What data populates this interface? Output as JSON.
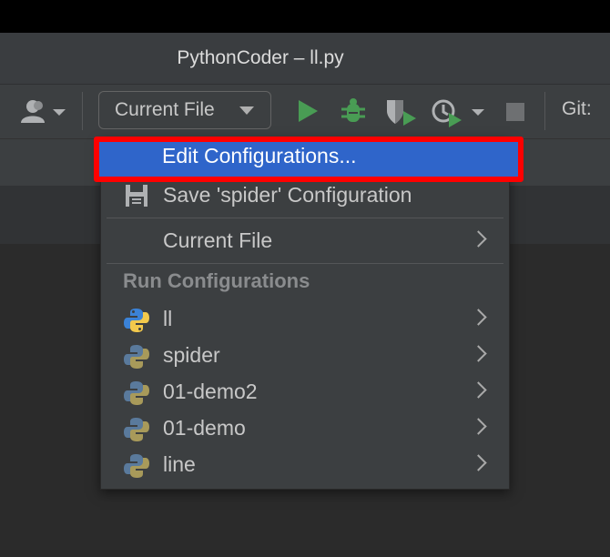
{
  "window": {
    "title": "PythonCoder – ll.py"
  },
  "toolbar": {
    "user_icon": "user-icon",
    "run_config_combo": "Current File",
    "run_icon": "run-icon",
    "debug_icon": "debug-icon",
    "coverage_icon": "coverage-icon",
    "profile_icon": "profile-icon",
    "stop_icon": "stop-icon",
    "git_label": "Git:"
  },
  "menu": {
    "edit_configurations": "Edit Configurations...",
    "save_configuration": "Save 'spider' Configuration",
    "current_file": "Current File",
    "section_header": "Run Configurations",
    "configs": [
      {
        "label": "ll"
      },
      {
        "label": "spider"
      },
      {
        "label": "01-demo2"
      },
      {
        "label": "01-demo"
      },
      {
        "label": "line"
      }
    ]
  },
  "colors": {
    "accent_run": "#499c54",
    "selection": "#2f65ca",
    "highlight_border": "#ff0000",
    "python_active_blue": "#3b82d6",
    "python_active_yellow": "#f2c94c"
  }
}
